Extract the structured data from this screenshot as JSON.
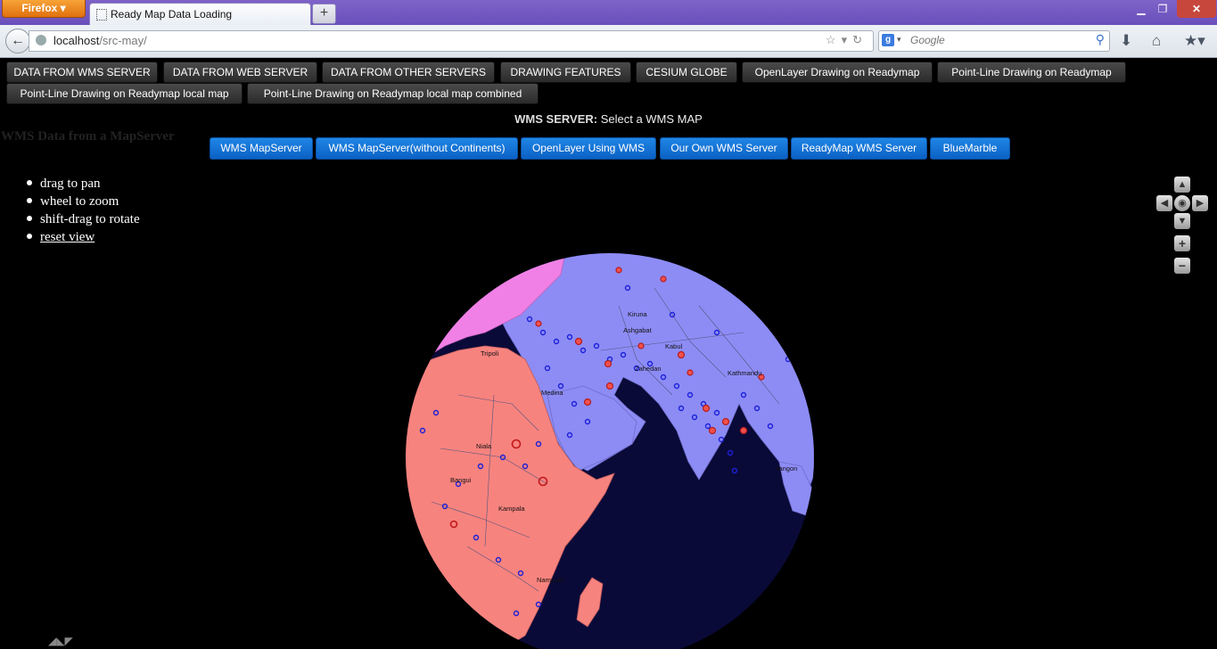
{
  "browser": {
    "app_button": "Firefox",
    "tab_title": "Ready Map Data Loading",
    "new_tab": "+",
    "url_host": "localhost",
    "url_path": "/src-may/",
    "search_placeholder": "Google",
    "window_controls": [
      "minimize",
      "restore",
      "close"
    ],
    "icons": [
      "back-arrow-icon",
      "globe-icon",
      "bookmark-star-icon",
      "reload-icon",
      "google-icon",
      "search-icon",
      "download-icon",
      "home-icon",
      "bookmarks-icon"
    ]
  },
  "menu": {
    "row1": [
      "DATA FROM WMS SERVER",
      "DATA FROM WEB SERVER",
      "DATA FROM OTHER SERVERS",
      "DRAWING FEATURES",
      "CESIUM GLOBE",
      "OpenLayer Drawing on Readymap",
      "Point-Line Drawing on Readymap"
    ],
    "row2": [
      "Point-Line Drawing on Readymap local map",
      "Point-Line Drawing on Readymap local map combined"
    ]
  },
  "wms": {
    "heading_bold": "WMS SERVER:",
    "heading_rest": " Select a WMS MAP",
    "side_title": "WMS Data from a MapServer",
    "buttons": [
      "WMS MapServer",
      "WMS MapServer(without Continents)",
      "OpenLayer Using WMS",
      "Our Own WMS Server",
      "ReadyMap WMS Server",
      "BlueMarble"
    ]
  },
  "help": {
    "items": [
      "drag to pan",
      "wheel to zoom",
      "shift-drag to rotate"
    ],
    "reset_link": "reset view"
  },
  "map_labels": [
    "Kiruna",
    "Tripoli",
    "Ashgabat",
    "Kabul",
    "Zahedan",
    "Medina",
    "Kathmandu",
    "Niala",
    "Bangui",
    "Kampala",
    "Nampula",
    "Yangon"
  ],
  "colors": {
    "africa": "#f7837e",
    "asia": "#8d8cf5",
    "europe": "#f080e6",
    "ocean": "#0a0a38",
    "accent_button": "#0b61c4"
  }
}
